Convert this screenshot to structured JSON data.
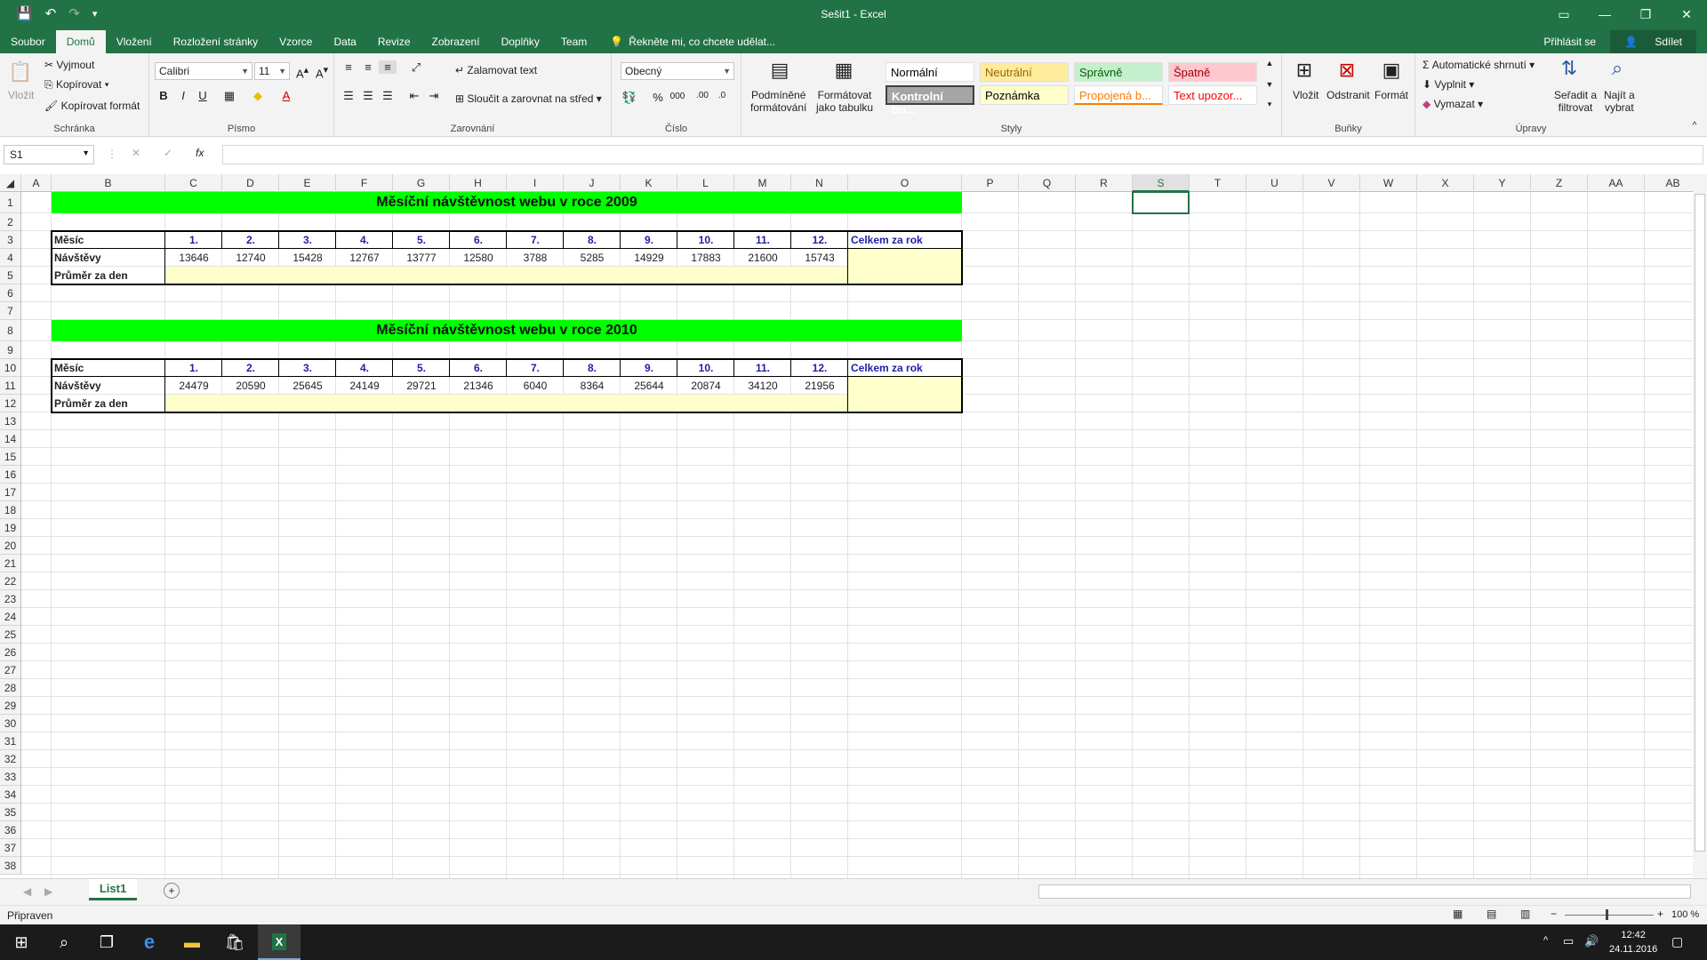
{
  "window": {
    "title": "Sešit1 - Excel"
  },
  "tabs": [
    {
      "label": "Soubor"
    },
    {
      "label": "Domů"
    },
    {
      "label": "Vložení"
    },
    {
      "label": "Rozložení stránky"
    },
    {
      "label": "Vzorce"
    },
    {
      "label": "Data"
    },
    {
      "label": "Revize"
    },
    {
      "label": "Zobrazení"
    },
    {
      "label": "Doplňky"
    },
    {
      "label": "Team"
    }
  ],
  "tell_me": "Řekněte mi, co chcete udělat...",
  "sign_in": "Přihlásit se",
  "share": "Sdílet",
  "ribbon": {
    "clipboard": {
      "paste": "Vložit",
      "cut": "Vyjmout",
      "copy": "Kopírovat",
      "format_painter": "Kopírovat formát",
      "label": "Schránka"
    },
    "font": {
      "name": "Calibri",
      "size": "11",
      "bold": "B",
      "italic": "I",
      "underline": "U",
      "label": "Písmo"
    },
    "alignment": {
      "wrap": "Zalamovat text",
      "merge": "Sloučit a zarovnat na střed",
      "label": "Zarovnání"
    },
    "number": {
      "format": "Obecný",
      "percent": "%",
      "thousands": "000",
      "label": "Číslo"
    },
    "styles": {
      "conditional": "Podmíněné formátování",
      "conditional_l1": "Podmíněné",
      "conditional_l2": "formátování",
      "as_table_l1": "Formátovat",
      "as_table_l2": "jako tabulku",
      "cells": [
        {
          "label": "Normální",
          "bg": "#ffffff",
          "fg": "#000000"
        },
        {
          "label": "Neutrální",
          "bg": "#ffeb9c",
          "fg": "#9c6500"
        },
        {
          "label": "Správně",
          "bg": "#c6efce",
          "fg": "#006100"
        },
        {
          "label": "Špatně",
          "bg": "#ffc7ce",
          "fg": "#9c0006"
        },
        {
          "label": "Kontrolní bu...",
          "bg": "#a5a5a5",
          "fg": "#ffffff"
        },
        {
          "label": "Poznámka",
          "bg": "#ffffcc",
          "fg": "#000000"
        },
        {
          "label": "Propojená b...",
          "bg": "#ffffff",
          "fg": "#fa7d00"
        },
        {
          "label": "Text upozor...",
          "bg": "#ffffff",
          "fg": "#ff0000"
        }
      ],
      "label": "Styly"
    },
    "cells_group": {
      "insert": "Vložit",
      "delete": "Odstranit",
      "format": "Formát",
      "label": "Buňky"
    },
    "editing": {
      "autosum": "Automatické shrnutí",
      "fill": "Vyplnit",
      "clear": "Vymazat",
      "sort_l1": "Seřadit a",
      "sort_l2": "filtrovat",
      "find_l1": "Najít a",
      "find_l2": "vybrat",
      "label": "Úpravy"
    }
  },
  "formula_bar": {
    "name_box": "S1",
    "fx": "fx",
    "value": ""
  },
  "columns": [
    "A",
    "B",
    "C",
    "D",
    "E",
    "F",
    "G",
    "H",
    "I",
    "J",
    "K",
    "L",
    "M",
    "N",
    "O",
    "P",
    "Q",
    "R",
    "S",
    "T",
    "U",
    "V",
    "W",
    "X",
    "Y",
    "Z",
    "AA",
    "AB"
  ],
  "selected_column": "S",
  "rows": [
    "1",
    "2",
    "3",
    "4",
    "5",
    "6",
    "7",
    "8",
    "9",
    "10",
    "11",
    "12",
    "13",
    "14",
    "15",
    "16",
    "17",
    "18",
    "19",
    "20",
    "21",
    "22",
    "23",
    "24",
    "25",
    "26",
    "27",
    "28",
    "29",
    "30",
    "31",
    "32",
    "33",
    "34",
    "35",
    "36",
    "37",
    "38"
  ],
  "tables": [
    {
      "title": "Měsíční návštěvnost webu v roce 2009",
      "header_label": "Měsíc",
      "months": [
        "1.",
        "2.",
        "3.",
        "4.",
        "5.",
        "6.",
        "7.",
        "8.",
        "9.",
        "10.",
        "11.",
        "12."
      ],
      "total_label": "Celkem za rok",
      "visits_label": "Návštěvy",
      "visits": [
        "13646",
        "12740",
        "15428",
        "12767",
        "13777",
        "12580",
        "3788",
        "5285",
        "14929",
        "17883",
        "21600",
        "15743"
      ],
      "avg_label": "Průměr za den"
    },
    {
      "title": "Měsíční návštěvnost webu v roce 2010",
      "header_label": "Měsíc",
      "months": [
        "1.",
        "2.",
        "3.",
        "4.",
        "5.",
        "6.",
        "7.",
        "8.",
        "9.",
        "10.",
        "11.",
        "12."
      ],
      "total_label": "Celkem za rok",
      "visits_label": "Návštěvy",
      "visits": [
        "24479",
        "20590",
        "25645",
        "24149",
        "29721",
        "21346",
        "6040",
        "8364",
        "25644",
        "20874",
        "34120",
        "21956"
      ],
      "avg_label": "Průměr za den"
    }
  ],
  "sheet_tabs": [
    {
      "label": "List1"
    }
  ],
  "status": {
    "ready": "Připraven",
    "zoom": "100 %"
  },
  "taskbar": {
    "time": "12:42",
    "date": "24.11.2016"
  },
  "colors": {
    "excel_green": "#217346",
    "title_band": "#00ff00",
    "input_fill": "#ffffcc",
    "header_blue": "#1f1fa8"
  }
}
